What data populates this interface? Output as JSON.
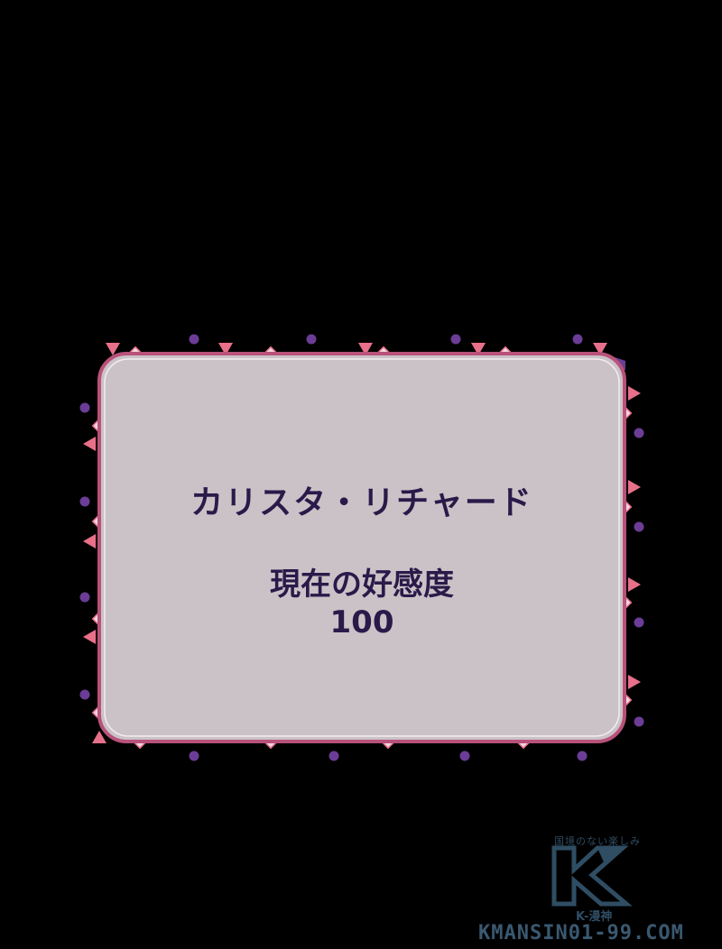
{
  "card": {
    "name": "カリスタ・リチャード",
    "label": "現在の好感度",
    "value": "100"
  },
  "colors": {
    "background": "#000000",
    "card_fill": "#cbc2c7",
    "card_border": "#b8527a",
    "pink": "#e8708a",
    "purple": "#6b3d96",
    "text": "#2a1a4a",
    "watermark": "#2f4d63"
  },
  "watermark": {
    "tagline": "国境のない楽しみ",
    "logo_letter": "K",
    "sub": "K-漫神",
    "url": "KMANSIN01-99.COM"
  }
}
